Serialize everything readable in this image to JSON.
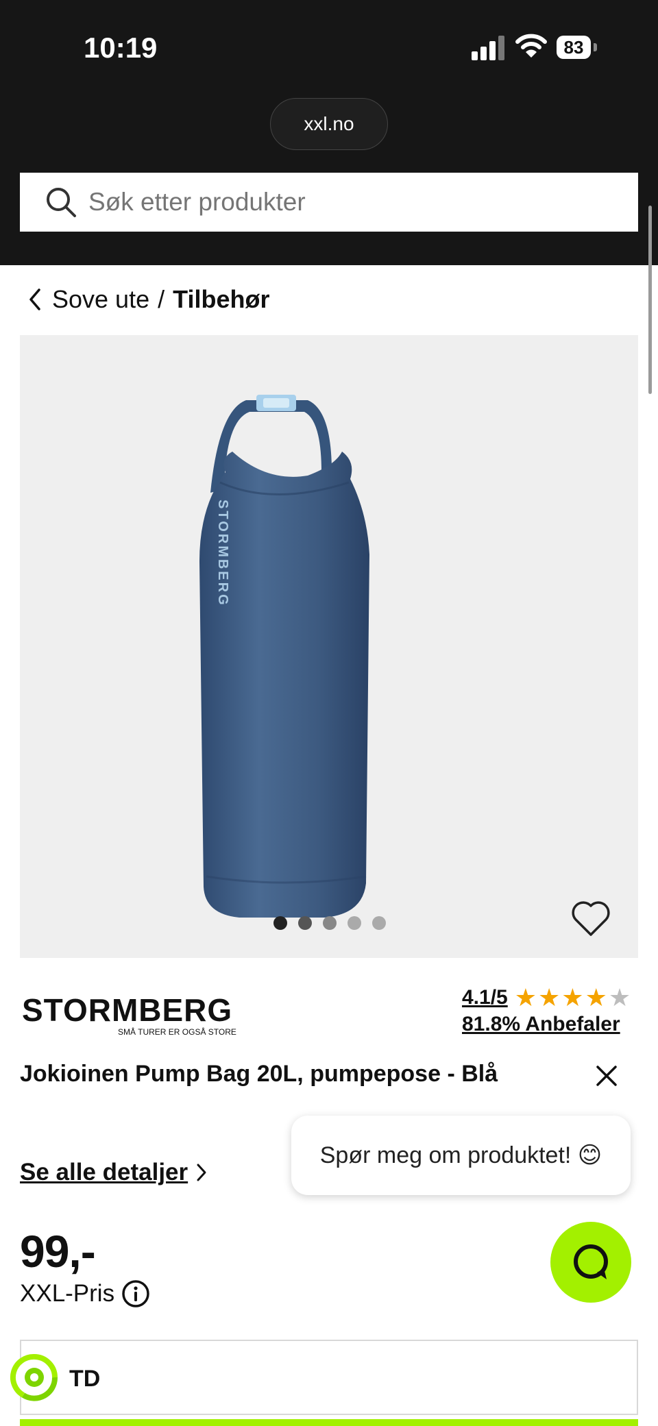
{
  "status_bar": {
    "time": "10:19",
    "battery": "83"
  },
  "browser": {
    "url": "xxl.no"
  },
  "search": {
    "placeholder": "Søk etter produkter"
  },
  "breadcrumb": {
    "parent": "Sove ute",
    "separator": "/",
    "current": "Tilbehør"
  },
  "gallery": {
    "dots": [
      "active",
      "inactive",
      "inactive",
      "inactive",
      "inactive"
    ],
    "colors": {
      "background": "#efefef",
      "bag": "#3d5a80",
      "buckle": "#a8d0ec"
    }
  },
  "brand": {
    "name": "STORMBERG",
    "tagline": "SMÅ TURER ER OGSÅ STORE"
  },
  "rating": {
    "score": "4.1/5",
    "stars_filled": 4,
    "stars_total": 5,
    "recommend": "81.8% Anbefaler"
  },
  "product": {
    "title": "Jokioinen Pump Bag 20L, pumpepose - Blå"
  },
  "chat": {
    "bubble_text": "Spør meg om produktet! 😊"
  },
  "details": {
    "link_label": "Se alle detaljer"
  },
  "price": {
    "value": "99,-",
    "label": "XXL-Pris"
  },
  "option": {
    "text": "TD"
  },
  "colors": {
    "accent": "#a3f000",
    "header": "#161616",
    "star": "#f5a300"
  }
}
